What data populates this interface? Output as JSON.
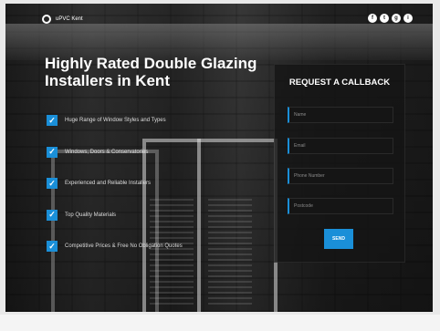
{
  "brand": {
    "name": "uPVC Kent",
    "logo_icon": "logo-mark-icon"
  },
  "socials": [
    {
      "icon": "facebook-icon",
      "glyph": "f"
    },
    {
      "icon": "twitter-icon",
      "glyph": "t"
    },
    {
      "icon": "google-plus-icon",
      "glyph": "g"
    },
    {
      "icon": "instagram-icon",
      "glyph": "i"
    }
  ],
  "hero": {
    "headline": "Highly Rated Double Glazing Installers in Kent"
  },
  "features": [
    "Huge Range of Window Styles and Types",
    "Windows, Doors & Conservatories",
    "Experienced and Reliable Installers",
    "Top Quality Materials",
    "Competitive Prices & Free No Obligation Quotes"
  ],
  "form": {
    "title": "REQUEST A CALLBACK",
    "fields": [
      {
        "placeholder": "Name"
      },
      {
        "placeholder": "Email"
      },
      {
        "placeholder": "Phone Number"
      },
      {
        "placeholder": "Postcode"
      }
    ],
    "send_label": "SEND"
  },
  "colors": {
    "accent": "#1a8fd8",
    "form_bg": "#141414"
  }
}
